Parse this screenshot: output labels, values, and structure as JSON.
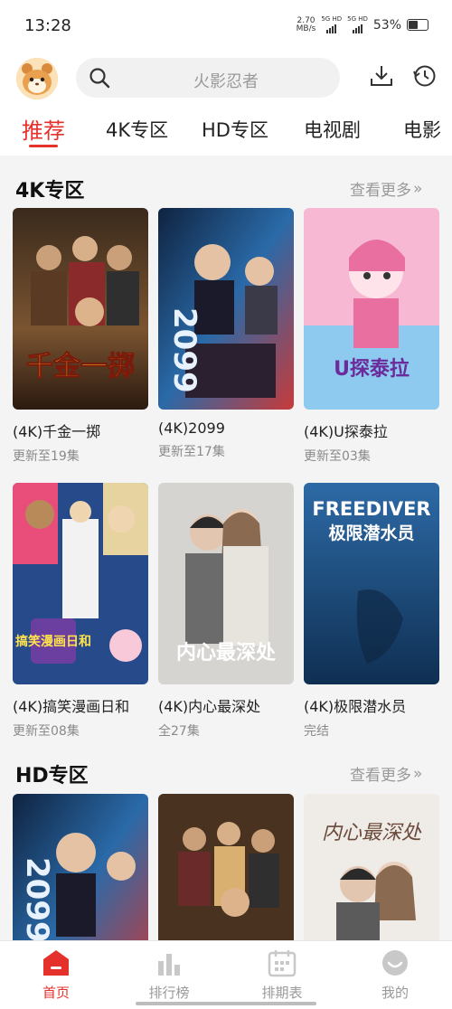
{
  "status_bar": {
    "time": "13:28",
    "speed_value": "2.70",
    "speed_unit": "MB/s",
    "net_a": "5G HD",
    "net_b": "5G HD",
    "battery": "53%"
  },
  "header": {
    "search_placeholder": "火影忍者",
    "icons": [
      "avatar-hamster-icon",
      "search-icon",
      "download-icon",
      "history-clock-icon"
    ]
  },
  "tabs": [
    {
      "label": "推荐",
      "active": true
    },
    {
      "label": "4K专区",
      "active": false
    },
    {
      "label": "HD专区",
      "active": false
    },
    {
      "label": "电视剧",
      "active": false
    },
    {
      "label": "电影",
      "active": false
    }
  ],
  "sections": [
    {
      "title": "4K专区",
      "more": "查看更多",
      "items": [
        {
          "title": "(4K)千金一掷",
          "sub": "更新至19集",
          "poster_text": "千金一掷",
          "colors": [
            "#3a2a1c",
            "#7a5431",
            "#c99a4a"
          ]
        },
        {
          "title": "(4K)2099",
          "sub": "更新至17集",
          "poster_text": "2099",
          "colors": [
            "#0f2340",
            "#2a6aa8",
            "#c83a3a"
          ]
        },
        {
          "title": "(4K)U探泰拉",
          "sub": "更新至03集",
          "poster_text": "U探泰拉",
          "colors": [
            "#e86fa0",
            "#f6a8c8",
            "#8ec9ef"
          ]
        },
        {
          "title": "(4K)搞笑漫画日和",
          "sub": "更新至08集",
          "poster_text": "搞笑漫画日和",
          "colors": [
            "#274a8a",
            "#e6d3a0",
            "#e94d7a"
          ]
        },
        {
          "title": "(4K)内心最深处",
          "sub": "全27集",
          "poster_text": "内心最深处",
          "colors": [
            "#c9c7c4",
            "#b8aaa0",
            "#5b5b5b"
          ]
        },
        {
          "title": "(4K)极限潜水员",
          "sub": "完结",
          "poster_text": "FREEDIVER",
          "poster_text2": "极限潜水员",
          "colors": [
            "#2d6aa6",
            "#1f4e7d",
            "#123a5e"
          ]
        }
      ]
    },
    {
      "title": "HD专区",
      "more": "查看更多",
      "items": [
        {
          "title": "",
          "sub": "",
          "poster_text": "2099",
          "colors": [
            "#0f2340",
            "#2a6aa8",
            "#c83a3a"
          ]
        },
        {
          "title": "",
          "sub": "",
          "poster_text": "",
          "colors": [
            "#3a2a1c",
            "#7a5431",
            "#c99a4a"
          ]
        },
        {
          "title": "",
          "sub": "",
          "poster_text": "内心最深处",
          "colors": [
            "#eeeae6",
            "#d9cfc6",
            "#9a8070"
          ]
        }
      ]
    }
  ],
  "bottom_nav": [
    {
      "label": "首页",
      "icon": "home-icon",
      "active": true
    },
    {
      "label": "排行榜",
      "icon": "ranking-icon",
      "active": false
    },
    {
      "label": "排期表",
      "icon": "calendar-icon",
      "active": false
    },
    {
      "label": "我的",
      "icon": "profile-icon",
      "active": false
    }
  ],
  "accent": "#e4312c"
}
